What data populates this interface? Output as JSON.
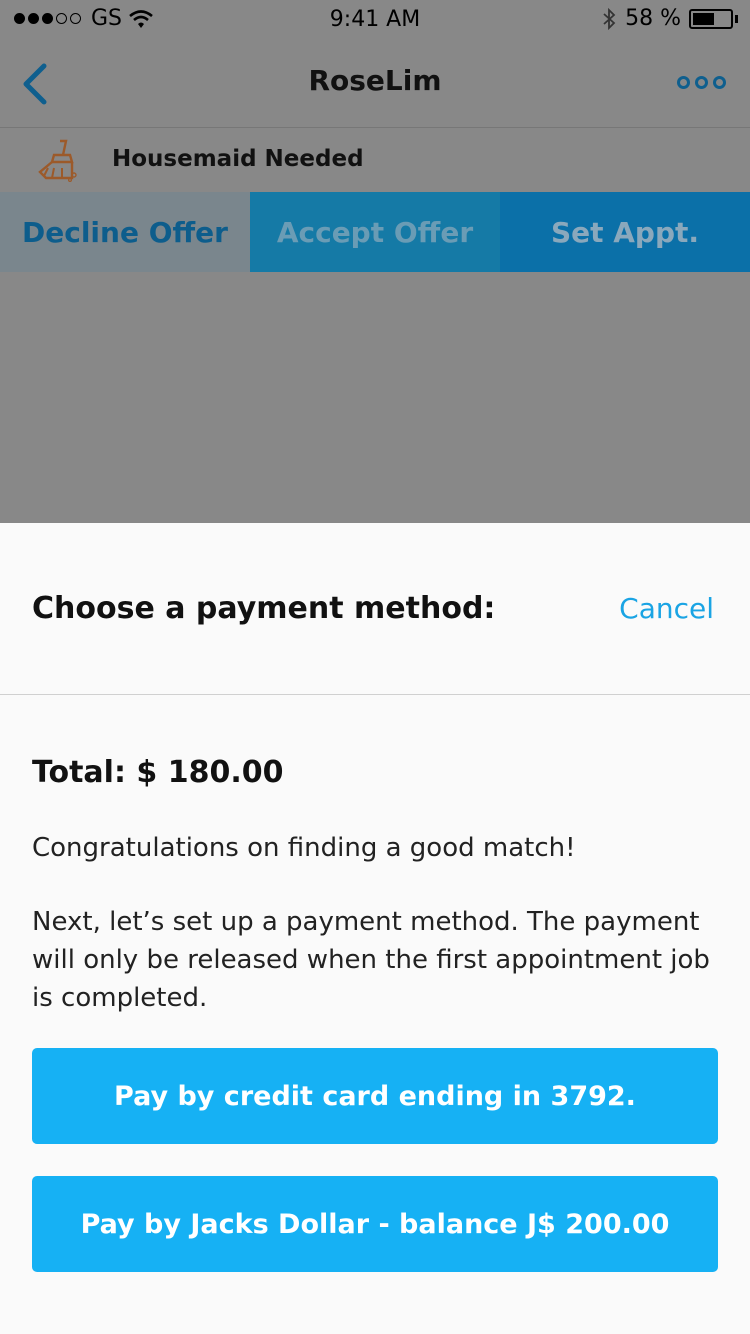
{
  "status_bar": {
    "carrier": "GS",
    "time": "9:41 AM",
    "battery_text": "58 %",
    "battery_level": 0.58
  },
  "navbar": {
    "title": "RoseLim"
  },
  "job": {
    "title": "Housemaid Needed"
  },
  "actions": {
    "decline": "Decline Offer",
    "accept": "Accept Offer",
    "appt": "Set Appt."
  },
  "sheet": {
    "title": "Choose a payment method:",
    "cancel": "Cancel",
    "total": "Total: $ 180.00",
    "congrats": "Congratulations on finding a good match!",
    "message": "Next, let’s set up a payment method. The payment will only be released when the first appointment job is completed.",
    "pay_card": "Pay by credit card ending in 3792.",
    "pay_jacks": "Pay by Jacks Dollar - balance J$ 200.00"
  },
  "colors": {
    "accent": "#16b1f4",
    "cancel": "#1aa4e4",
    "dimmed": "#888888"
  }
}
